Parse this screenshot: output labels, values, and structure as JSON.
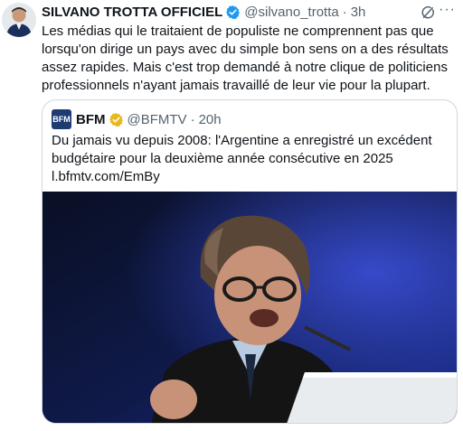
{
  "tweet": {
    "author_name": "SILVANO TROTTA OFFICIEL",
    "handle": "@silvano_trotta",
    "separator": "·",
    "time": "3h",
    "more_label": "···",
    "text": "Les médias qui le traitaient de populiste ne comprennent pas que lorsqu'on dirige un pays avec du simple bon sens on a des résultats assez rapides. Mais c'est trop demandé à notre clique de politiciens professionnels n'ayant jamais travaillé de leur vie pour la plupart."
  },
  "quote": {
    "logo_text": "BFM",
    "author_name": "BFM",
    "handle": "@BFMTV",
    "separator": "·",
    "time": "20h",
    "text": "Du jamais vu depuis 2008: l'Argentine a enregistré un excédent budgétaire pour la deuxième année consécutive en 2025",
    "link": "l.bfmtv.com/EmBy"
  },
  "colors": {
    "verified_blue": "#1d9bf0",
    "verified_gold": "#e8b81c",
    "secondary_text": "#536471",
    "border": "#cfd9de"
  },
  "icons": [
    "avatar",
    "verified-badge-icon",
    "grok-icon",
    "more-options-icon",
    "gold-verified-badge-icon"
  ]
}
